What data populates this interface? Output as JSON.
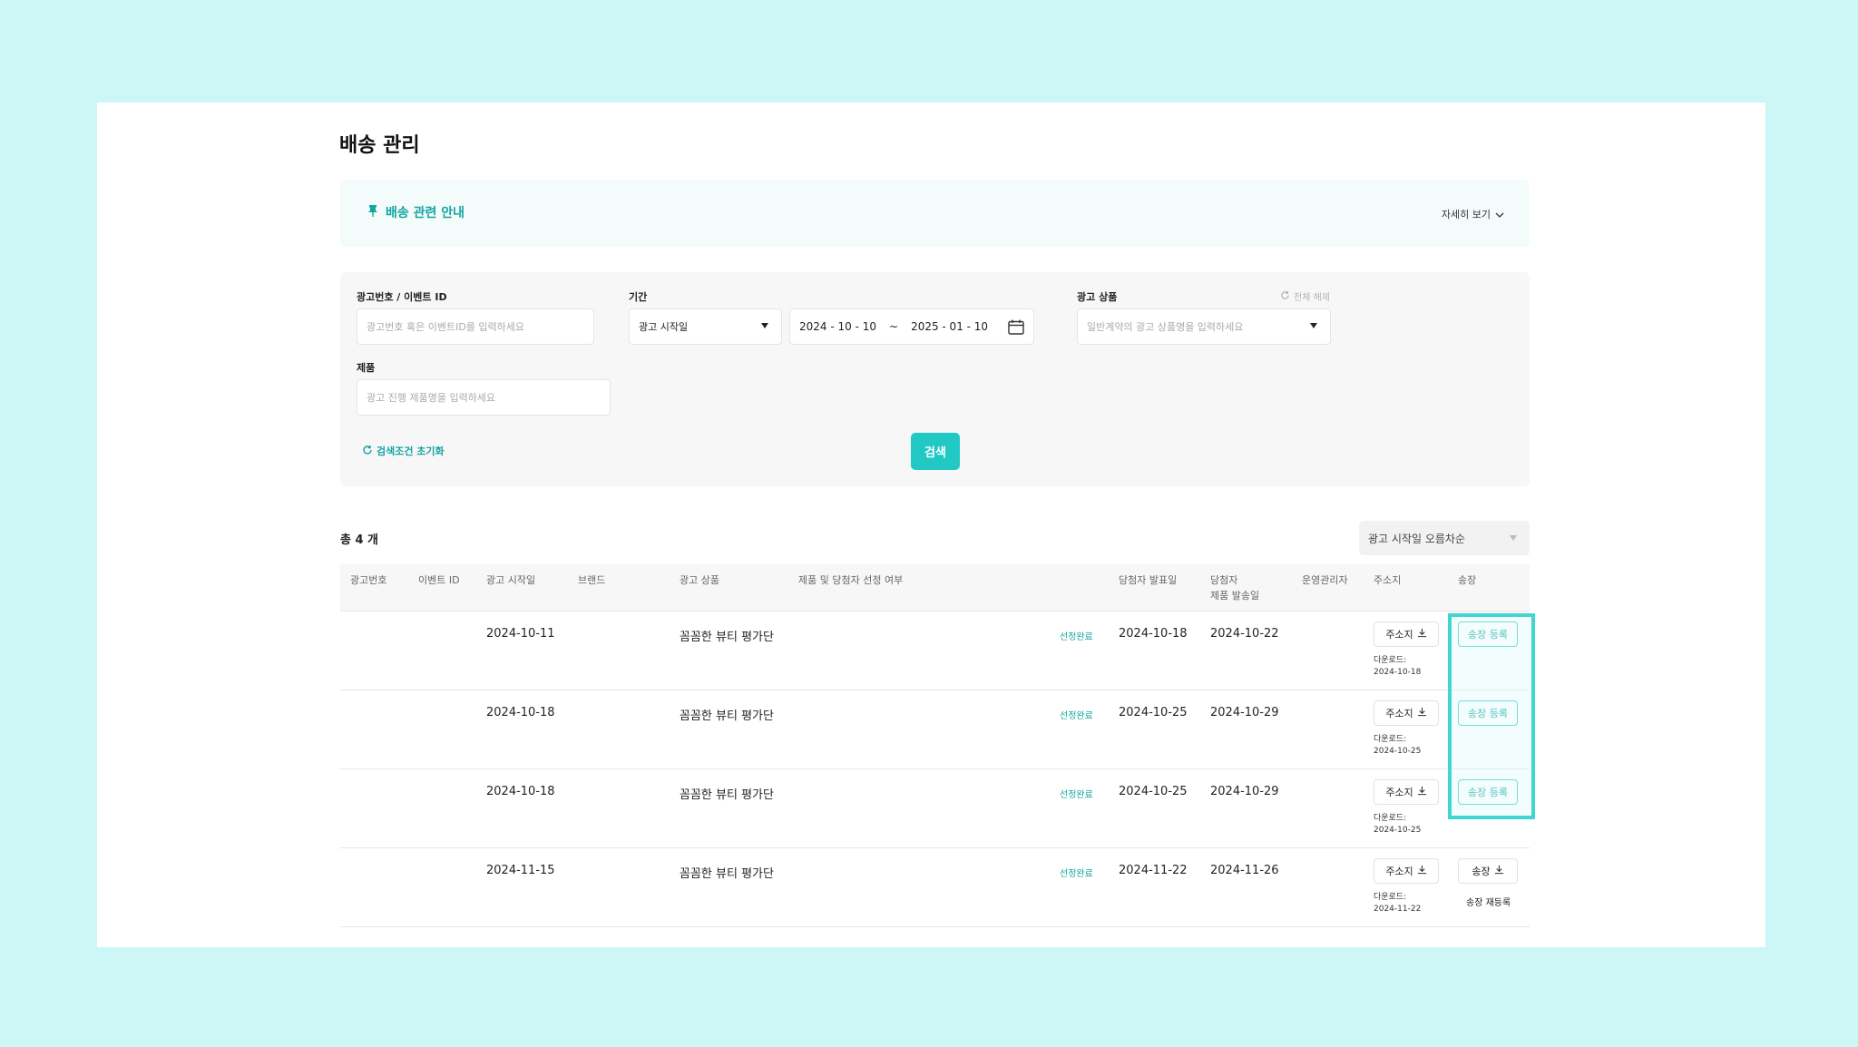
{
  "page_title": "배송 관리",
  "notice": {
    "title": "배송 관련 안내",
    "more_label": "자세히 보기"
  },
  "filters": {
    "ad_id": {
      "label": "광고번호 / 이벤트 ID",
      "placeholder": "광고번호 혹은 이벤트ID를 입력하세요"
    },
    "period": {
      "label": "기간",
      "type_value": "광고 시작일",
      "start": "2024 - 10 - 10",
      "sep": "~",
      "end": "2025 - 01 - 10"
    },
    "ad_product": {
      "label": "광고 상품",
      "placeholder": "일반계약의 광고 상품명을 입력하세요",
      "reset_all": "전체 해제"
    },
    "product": {
      "label": "제품",
      "placeholder": "광고 진행 제품명을 입력하세요"
    },
    "reset_label": "검색조건 초기화",
    "search_label": "검색"
  },
  "list": {
    "total": "총 4 개",
    "sort_value": "광고 시작일 오름차순",
    "columns": [
      "광고번호",
      "이벤트 ID",
      "광고 시작일",
      "브랜드",
      "광고 상품",
      "제품 및 당첨자 선정 여부",
      "당첨자 발표일",
      "당첨자",
      "제품 발송일",
      "운영관리자",
      "주소지",
      "송장"
    ],
    "rows": [
      {
        "start": "2024-10-11",
        "product": "꼼꼼한 뷰티 평가단",
        "status": "선정완료",
        "announce": "2024-10-18",
        "ship": "2024-10-22",
        "address_btn": "주소지",
        "dl_label": "다운로드:",
        "dl_date": "2024-10-18",
        "invoice_btn": "송장 등록"
      },
      {
        "start": "2024-10-18",
        "product": "꼼꼼한 뷰티 평가단",
        "status": "선정완료",
        "announce": "2024-10-25",
        "ship": "2024-10-29",
        "address_btn": "주소지",
        "dl_label": "다운로드:",
        "dl_date": "2024-10-25",
        "invoice_btn": "송장 등록"
      },
      {
        "start": "2024-10-18",
        "product": "꼼꼼한 뷰티 평가단",
        "status": "선정완료",
        "announce": "2024-10-25",
        "ship": "2024-10-29",
        "address_btn": "주소지",
        "dl_label": "다운로드:",
        "dl_date": "2024-10-25",
        "invoice_btn": "송장 등록"
      },
      {
        "start": "2024-11-15",
        "product": "꼼꼼한 뷰티 평가단",
        "status": "선정완료",
        "announce": "2024-11-22",
        "ship": "2024-11-26",
        "address_btn": "주소지",
        "dl_label": "다운로드:",
        "dl_date": "2024-11-22",
        "invoice_btn": "송장",
        "invoice_sub": "송장 재등록"
      }
    ]
  },
  "colors": {
    "accent": "#22c9c4",
    "accent_text": "#14a5a0",
    "backdrop": "#cdf7f6",
    "highlight": "#3fd6d4"
  },
  "icons": [
    "pin-icon",
    "chevron-down-icon",
    "refresh-icon",
    "calendar-icon",
    "download-icon"
  ]
}
